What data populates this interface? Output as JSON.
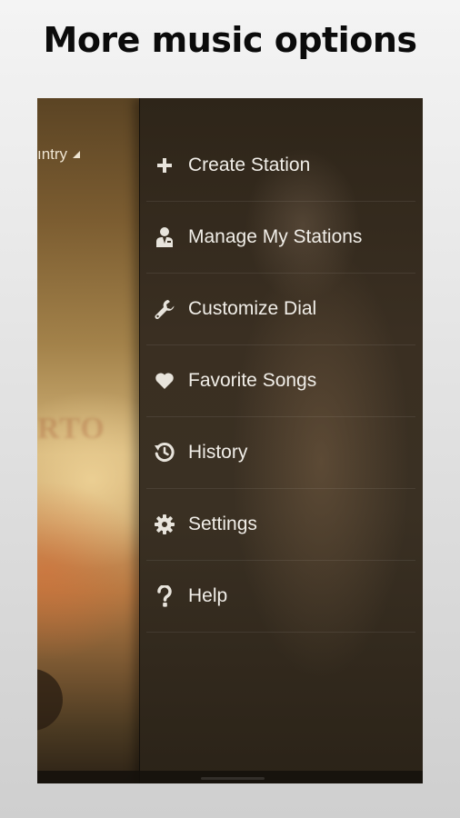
{
  "headline": "More music options",
  "player": {
    "genre_label": "ıntry",
    "faint_text": "RTO"
  },
  "menu": {
    "items": [
      {
        "label": "Create Station",
        "icon": "plus-icon"
      },
      {
        "label": "Manage My Stations",
        "icon": "person-icon"
      },
      {
        "label": "Customize Dial",
        "icon": "wrench-icon"
      },
      {
        "label": "Favorite Songs",
        "icon": "heart-icon"
      },
      {
        "label": "History",
        "icon": "history-icon"
      },
      {
        "label": "Settings",
        "icon": "gear-icon"
      },
      {
        "label": "Help",
        "icon": "question-icon"
      }
    ]
  },
  "colors": {
    "menu_text": "#f1eee8",
    "icon": "#e8e4dc",
    "headline": "#0b0b0b"
  }
}
